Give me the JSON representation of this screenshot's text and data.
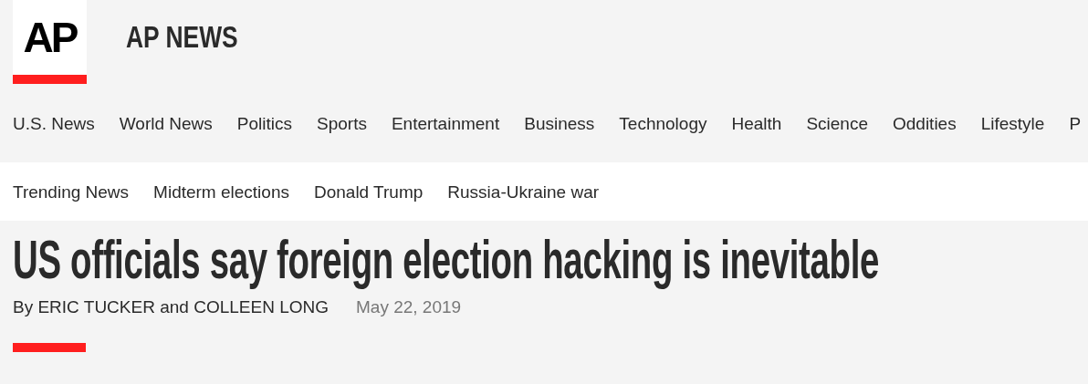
{
  "logo": {
    "mark": "AP",
    "name": "AP NEWS"
  },
  "nav": [
    "U.S. News",
    "World News",
    "Politics",
    "Sports",
    "Entertainment",
    "Business",
    "Technology",
    "Health",
    "Science",
    "Oddities",
    "Lifestyle",
    "P"
  ],
  "trending": [
    "Trending News",
    "Midterm elections",
    "Donald Trump",
    "Russia-Ukraine war"
  ],
  "article": {
    "headline": "US officials say foreign election hacking is inevitable",
    "byline": "By ERIC TUCKER and COLLEEN LONG",
    "date": "May 22, 2019"
  }
}
